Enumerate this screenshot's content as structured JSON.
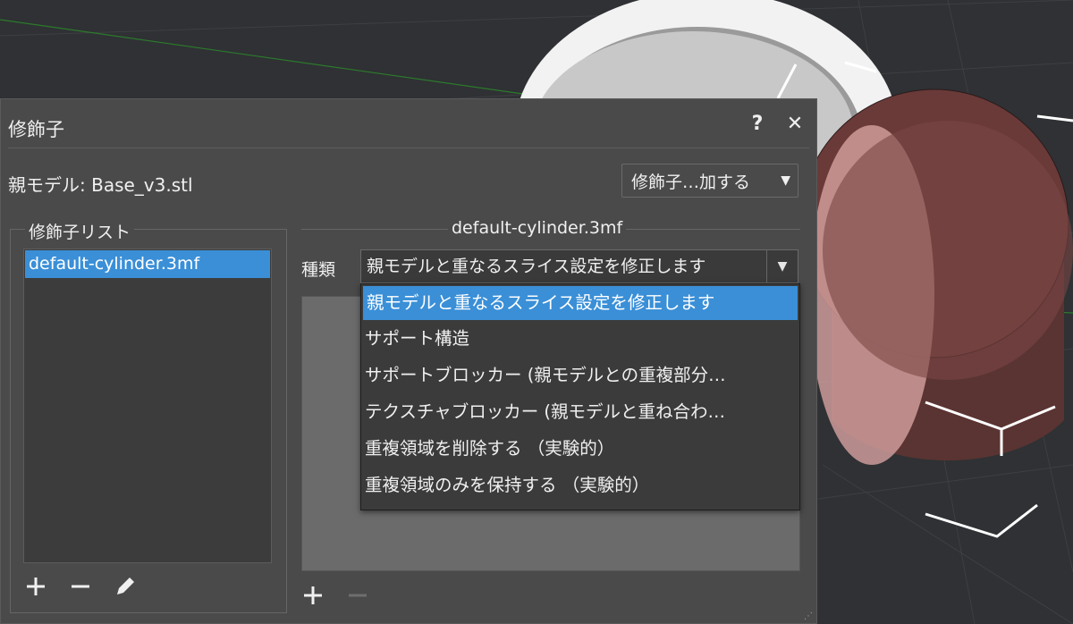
{
  "dialog": {
    "title": "修飾子",
    "help_label": "?",
    "close_label": "✕",
    "parent_model_label": "親モデル: Base_v3.stl",
    "add_modifier_label": "修飾子…加する"
  },
  "modifier_list": {
    "title": "修飾子リスト",
    "items": [
      "default-cylinder.3mf"
    ],
    "selected_index": 0
  },
  "modifier_settings": {
    "title": "default-cylinder.3mf",
    "type_label": "種類",
    "type_value": "親モデルと重なるスライス設定を修正します",
    "options": [
      "親モデルと重なるスライス設定を修正します",
      "サポート構造",
      "サポートブロッカー (親モデルとの重複部分…",
      "テクスチャブロッカー (親モデルと重ね合わ…",
      "重複領域を削除する （実験的）",
      "重複領域のみを保持する （実験的）"
    ],
    "selected_option_index": 0
  },
  "icons": {
    "add": "plus-icon",
    "remove": "minus-icon",
    "edit": "pencil-icon",
    "dropdown": "caret-down-icon"
  },
  "colors": {
    "accent": "#3a8fd7",
    "dialog_bg": "#4a4a4a",
    "viewport_bg": "#2f3134",
    "model_red": "#8a4a48"
  }
}
